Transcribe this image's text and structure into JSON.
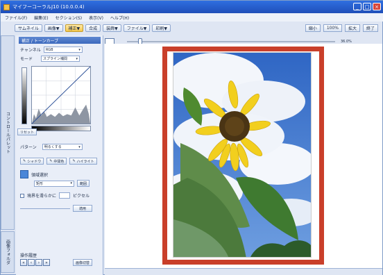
{
  "window": {
    "title": "マイフーコーラルJ10 (10.0.0.4)"
  },
  "menu": [
    "ファイル(F)",
    "編集(E)",
    "セクション(S)",
    "表示(V)",
    "ヘルプ(H)"
  ],
  "toolbar": {
    "buttons": [
      "サムネイル",
      "画像▼",
      "補正▼",
      "合成",
      "装飾▼",
      "ファイル▼",
      "印刷▼"
    ],
    "right_buttons": [
      "縮小",
      "100%",
      "拡大",
      "終了"
    ]
  },
  "view": {
    "zoom": "36.0%"
  },
  "side_tabs": {
    "top": "コントロールパレット",
    "bottom": "画像フォルダ"
  },
  "panel": {
    "header": "補正 / トーンカーブ",
    "channel_label": "チャンネル",
    "channel_value": "RGB",
    "mode_label": "モード",
    "mode_value": "スプライン補間",
    "reset_label": "リセット",
    "pattern_label": "パターン",
    "pattern_value": "明るくする",
    "shadow_label": "シャドウ",
    "mid_label": "中間色",
    "highlight_label": "ハイライト",
    "area_label": "領域選択",
    "area_value": "矩形",
    "invert_label": "範囲",
    "range_hint": "境界を滑らかに",
    "pixel_label": "ピクセル",
    "apply_label": "適用",
    "history_label": "操作履歴",
    "switch_label": "画像切替"
  },
  "colors": {
    "frame": "#c93f2a",
    "accent": "#3c69bd"
  }
}
